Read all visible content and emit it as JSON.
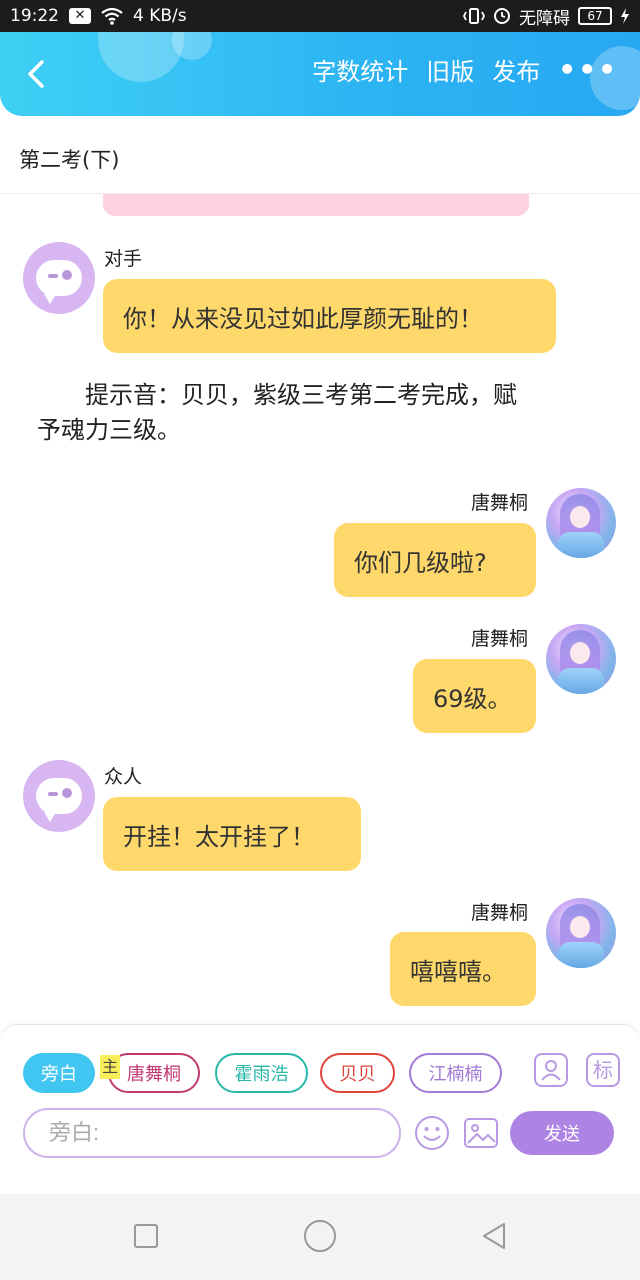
{
  "status_bar": {
    "time": "19:22",
    "network_speed": "4 KB/s",
    "accessibility": "无障碍",
    "battery": "67",
    "icons": [
      "close-box-icon",
      "wifi-icon",
      "vibrate-icon",
      "alarm-icon",
      "charging-icon"
    ]
  },
  "header": {
    "word_count": "字数统计",
    "old_version": "旧版",
    "publish": "发布",
    "more": "•••",
    "gradient_start": "#3fd0f4",
    "gradient_end": "#28a8f2"
  },
  "chapter_title": "第二考(下)",
  "chat": [
    {
      "side": "left",
      "name": "对手",
      "text": "你！从来没见过如此厚颜无耻的！"
    },
    {
      "type": "narration",
      "text_line1": "提示音：贝贝，紫级三考第二考完成，赋",
      "text_line2": "予魂力三级。"
    },
    {
      "side": "right",
      "name": "唐舞桐",
      "text": "你们几级啦?"
    },
    {
      "side": "right",
      "name": "唐舞桐",
      "text": "69级。"
    },
    {
      "side": "left",
      "name": "众人",
      "text": "开挂！太开挂了！"
    },
    {
      "side": "right",
      "name": "唐舞桐",
      "text": "嘻嘻嘻。"
    }
  ],
  "panel": {
    "characters": [
      "旁白",
      "唐舞桐",
      "霍雨浩",
      "贝贝",
      "江楠楠"
    ],
    "main_tag": "主",
    "side_button_label": "标",
    "input_placeholder": "旁白:",
    "send_label": "发送",
    "message_bubble_color": "#fed86a"
  }
}
